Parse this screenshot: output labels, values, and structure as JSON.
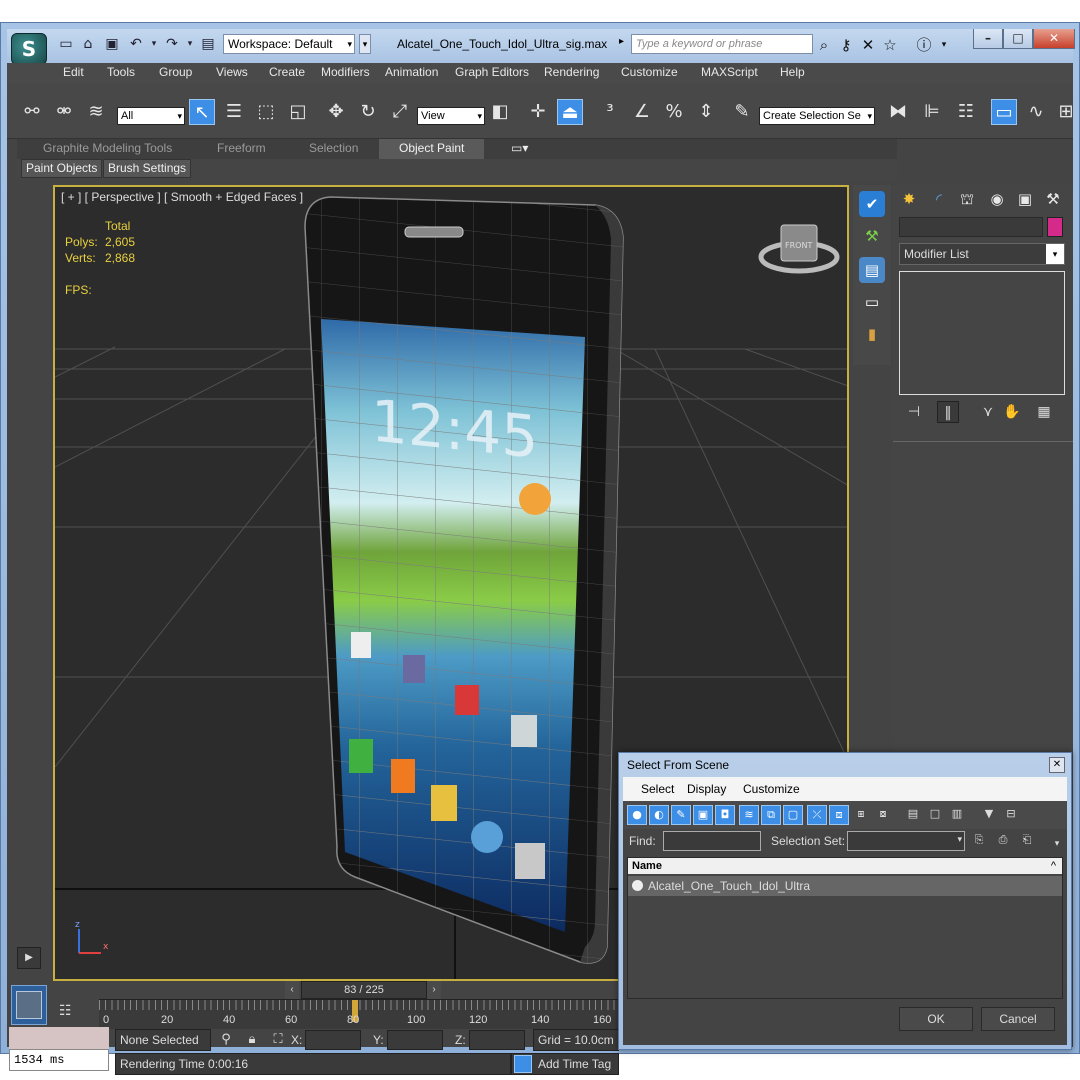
{
  "app": {
    "logo": "S",
    "workspace": "Workspace: Default",
    "doc_title": "Alcatel_One_Touch_Idol_Ultra_sig.max",
    "search_placeholder": "Type a keyword or phrase"
  },
  "menu": [
    "Edit",
    "Tools",
    "Group",
    "Views",
    "Create",
    "Modifiers",
    "Animation",
    "Graph Editors",
    "Rendering",
    "Customize",
    "MAXScript",
    "Help"
  ],
  "toolbar": {
    "selection_filter": "All",
    "ref_coord": "View",
    "named_selection": "Create Selection Se"
  },
  "ribbon": {
    "tabs": [
      "Graphite Modeling Tools",
      "Freeform",
      "Selection",
      "Object Paint"
    ],
    "active_tab": "Object Paint",
    "sub_buttons": [
      "Paint Objects",
      "Brush Settings"
    ]
  },
  "viewport": {
    "label": "[ + ] [ Perspective ] [ Smooth + Edged Faces ]",
    "stats": {
      "total_label": "Total",
      "polys_label": "Polys:",
      "polys": "2,605",
      "verts_label": "Verts:",
      "verts": "2,868",
      "fps_label": "FPS:"
    },
    "viewcube": "FRONT",
    "axis": {
      "z": "z",
      "x": "x"
    },
    "phone_screen": {
      "time": "12:45"
    }
  },
  "command_panel": {
    "modifier_list": "Modifier List",
    "object_color": "#d42a8a"
  },
  "timeline": {
    "frame": "83 / 225",
    "current_frame": 83,
    "total_frames": 225,
    "ticks": [
      "0",
      "20",
      "40",
      "60",
      "80",
      "100",
      "120",
      "140",
      "160"
    ]
  },
  "status": {
    "listener": "1534 ms",
    "selection": "None Selected",
    "x_label": "X:",
    "y_label": "Y:",
    "z_label": "Z:",
    "grid": "Grid = 10.0cm",
    "render_time": "Rendering Time  0:00:16",
    "add_time_tag": "Add Time Tag"
  },
  "dialog": {
    "title": "Select From Scene",
    "menu": [
      "Select",
      "Display",
      "Customize"
    ],
    "find_label": "Find:",
    "selection_set_label": "Selection Set:",
    "column_name": "Name",
    "items": [
      "Alcatel_One_Touch_Idol_Ultra"
    ],
    "ok": "OK",
    "cancel": "Cancel"
  }
}
